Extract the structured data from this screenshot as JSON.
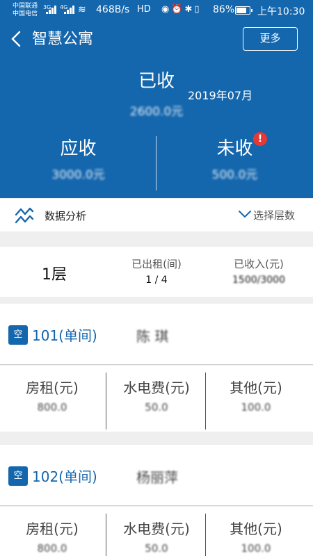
{
  "status_bar": {
    "carrier1": "中国联通",
    "carrier2": "中国电信",
    "net1": "3G",
    "net2": "4G",
    "speed": "468B/s",
    "hd": "HD",
    "battery": "86%",
    "time": "上午10:30"
  },
  "header": {
    "title": "智慧公寓",
    "more_label": "更多",
    "received_label": "已收",
    "period": "2019年07月",
    "received_amount": "2600.0元",
    "receivable_label": "应收",
    "receivable_amount": "3000.0元",
    "unreceived_label": "未收",
    "unreceived_amount": "500.0元",
    "alert_glyph": "!"
  },
  "analysis": {
    "label": "数据分析",
    "floor_select_label": "选择层数"
  },
  "floor": {
    "name": "1层",
    "rented_label": "已出租(间)",
    "rented_value": "1 / 4",
    "income_label": "已收入(元)",
    "income_value": "1500/3000"
  },
  "units": [
    {
      "badge": "空",
      "name": "101(单间)",
      "tenant": "陈 琪",
      "rent_label": "房租(元)",
      "rent_value": "800.0",
      "utility_label": "水电费(元)",
      "utility_value": "50.0",
      "other_label": "其他(元)",
      "other_value": "100.0"
    },
    {
      "badge": "空",
      "name": "102(单间)",
      "tenant": "杨丽萍",
      "rent_label": "房租(元)",
      "rent_value": "800.0",
      "utility_label": "水电费(元)",
      "utility_value": "50.0",
      "other_label": "其他(元)",
      "other_value": "100.0"
    }
  ],
  "colors": {
    "primary": "#1466ad",
    "alert": "#e53935",
    "background": "#efefef"
  }
}
